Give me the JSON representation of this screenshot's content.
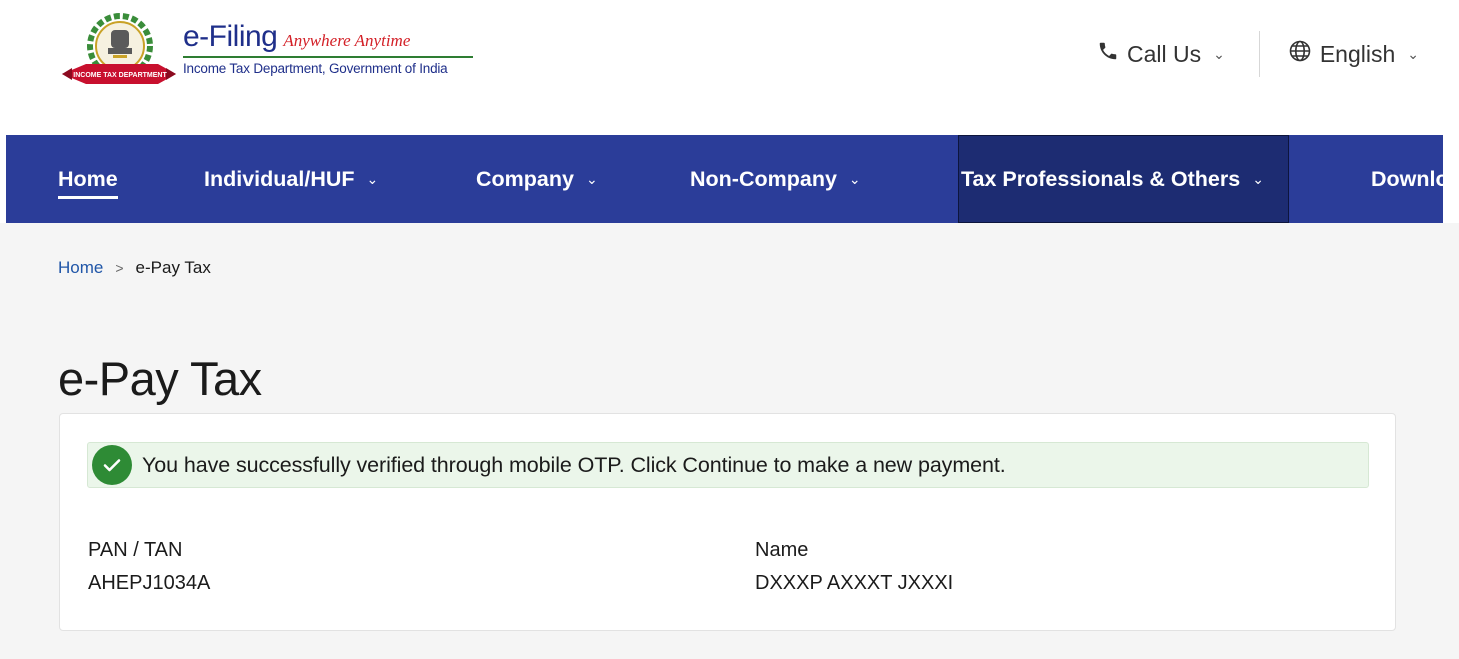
{
  "header": {
    "brand_title": "e-Filing",
    "brand_tagline": "Anywhere Anytime",
    "brand_subtitle": "Income Tax Department, Government of India",
    "emblem_banner_text": "INCOME TAX DEPARTMENT",
    "call_us": "Call Us",
    "language": "English"
  },
  "nav": {
    "items": [
      {
        "label": "Home"
      },
      {
        "label": "Individual/HUF"
      },
      {
        "label": "Company"
      },
      {
        "label": "Non-Company"
      },
      {
        "label": "Tax Professionals & Others"
      },
      {
        "label": "Downloads"
      }
    ]
  },
  "breadcrumb": {
    "home": "Home",
    "separator": ">",
    "current": "e-Pay Tax"
  },
  "page": {
    "title": "e-Pay Tax"
  },
  "alert": {
    "message": "You have successfully verified through mobile OTP. Click Continue to make a new payment."
  },
  "details": {
    "pan_label": "PAN / TAN",
    "pan_value": "AHEPJ1034A",
    "name_label": "Name",
    "name_value": "DXXXP AXXXT JXXXI"
  },
  "colors": {
    "nav_bg": "#2b3d99",
    "brand_blue": "#1f2f8a",
    "tagline_red": "#d32027",
    "success_green": "#2e8b35",
    "alert_bg": "#ebf6ea"
  }
}
